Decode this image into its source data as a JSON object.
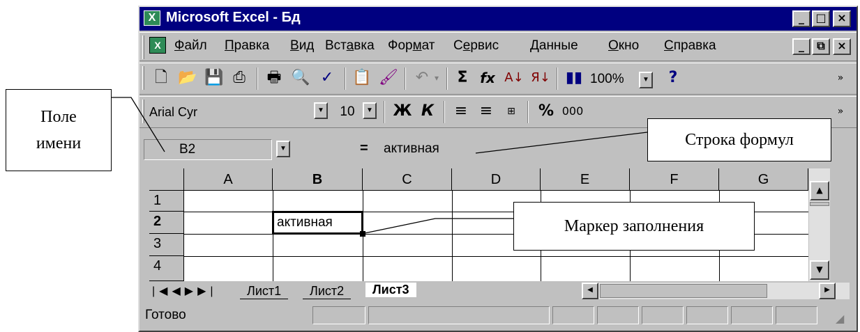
{
  "window": {
    "title": "Microsoft Excel - Бд",
    "app_icon": "excel-icon"
  },
  "menu": {
    "items": [
      {
        "u": "Ф",
        "rest": "айл"
      },
      {
        "u": "П",
        "rest": "равка"
      },
      {
        "u": "В",
        "rest": "ид"
      },
      {
        "pre": "Вст",
        "u": "а",
        "rest": "вка"
      },
      {
        "pre": "Фор",
        "u": "м",
        "rest": "ат"
      },
      {
        "pre": "С",
        "u": "е",
        "rest": "рвис"
      },
      {
        "u": "Д",
        "rest": "анные"
      },
      {
        "u": "О",
        "rest": "кно"
      },
      {
        "u": "С",
        "rest": "правка"
      }
    ]
  },
  "toolbar": {
    "zoom": "100%"
  },
  "format": {
    "font": "Arial Cyr",
    "size": "10",
    "bold": "Ж",
    "italic": "К",
    "percent": "%",
    "thousands": "000"
  },
  "formula_bar": {
    "name_box": "B2",
    "equals": "=",
    "value": "активная"
  },
  "grid": {
    "columns": [
      "A",
      "B",
      "C",
      "D",
      "E",
      "F",
      "G"
    ],
    "rows": [
      "1",
      "2",
      "3",
      "4"
    ],
    "active_cell_text": "активная"
  },
  "sheets": {
    "tabs": [
      "Лист1",
      "Лист2",
      "Лист3"
    ],
    "active": "Лист3"
  },
  "status": {
    "text": "Готово"
  },
  "callouts": {
    "name_box": [
      "Поле",
      "имени"
    ],
    "formula_bar": "Строка формул",
    "fill_handle": "Маркер заполнения"
  }
}
